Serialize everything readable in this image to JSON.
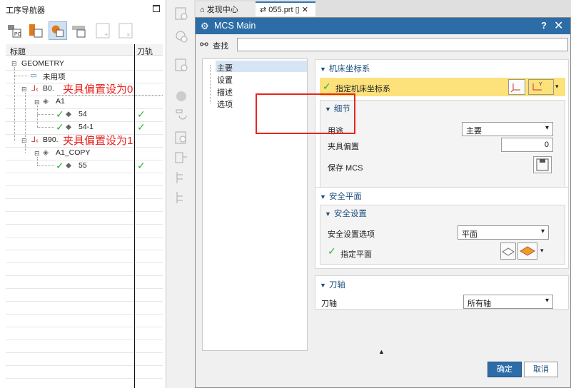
{
  "navigator": {
    "title": "工序导航器",
    "col_title": "标题",
    "col_toolpath": "刀轨",
    "tree": [
      {
        "label": "GEOMETRY"
      },
      {
        "label": "未用项"
      },
      {
        "label": "B0."
      },
      {
        "label": "A1"
      },
      {
        "label": "54"
      },
      {
        "label": "54-1"
      },
      {
        "label": "B90."
      },
      {
        "label": "A1_COPY"
      },
      {
        "label": "55"
      }
    ],
    "notes": [
      "夹具偏置设为0",
      "夹具偏置设为1"
    ]
  },
  "tabs": [
    {
      "label": "发现中心"
    },
    {
      "label": "055.prt"
    }
  ],
  "dialog": {
    "title": "MCS Main",
    "help": "?",
    "close": "✕",
    "search_label": "查找",
    "search_value": "",
    "list": [
      "主要",
      "设置",
      "描述",
      "选项"
    ],
    "sec1": {
      "title": "机床坐标系",
      "specify": "指定机床坐标系",
      "detail_title": "细节",
      "usage_label": "用途",
      "usage_value": "主要",
      "fixture_label": "夹具偏置",
      "fixture_value": "0",
      "save_label": "保存 MCS"
    },
    "sec2": {
      "title": "安全平面",
      "sub_title": "安全设置",
      "option_label": "安全设置选项",
      "option_value": "平面",
      "plane_label": "指定平面"
    },
    "sec3": {
      "title": "刀轴",
      "axis_label": "刀轴",
      "axis_value": "所有轴"
    },
    "ok": "确定",
    "cancel": "取消"
  },
  "colors": {
    "accent": "#2c6da8",
    "highlight": "#fde17a",
    "note_red": "#e8231f",
    "check_green": "#2db03a"
  }
}
